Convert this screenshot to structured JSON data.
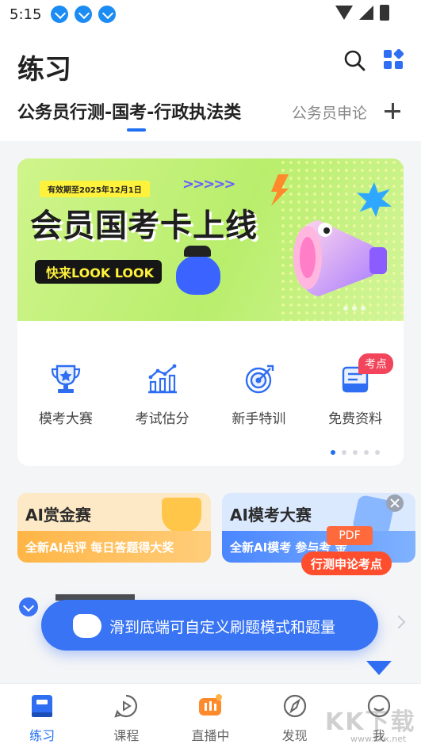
{
  "status_bar": {
    "time": "5:15"
  },
  "header": {
    "title": "练习"
  },
  "tabs": {
    "active": "公务员行测-国考-行政执法类",
    "other": "公务员申论"
  },
  "banner": {
    "validity": "有效期至2025年12月1日",
    "headline": "会员国考卡上线",
    "cta": "快来LOOK LOOK"
  },
  "quick_actions": {
    "items": [
      {
        "label": "模考大赛",
        "icon": "trophy-icon"
      },
      {
        "label": "考试估分",
        "icon": "bar-chart-icon"
      },
      {
        "label": "新手特训",
        "icon": "target-icon"
      },
      {
        "label": "免费资料",
        "icon": "document-icon"
      }
    ],
    "badge": "考点"
  },
  "promos": {
    "left": {
      "title": "AI赏金赛",
      "subtitle": "全新AI点评 每日答题得大奖"
    },
    "right": {
      "title": "AI模考大赛",
      "subtitle": "全新AI模考 参与考 金",
      "pdf_tag": "PDF",
      "pill": "行测申论考点"
    }
  },
  "toast": {
    "text": "滑到底端可自定义刷题模式和题量"
  },
  "bottom_nav": {
    "items": [
      {
        "label": "练习"
      },
      {
        "label": "课程"
      },
      {
        "label": "直播中"
      },
      {
        "label": "发现"
      },
      {
        "label": "我"
      }
    ]
  },
  "watermark": {
    "text": "KK下载",
    "url": "www.kkx.net"
  },
  "colors": {
    "accent": "#1f6ff2",
    "toast": "#3874f4",
    "badge": "#f2455b",
    "banner": "#bff07a"
  }
}
